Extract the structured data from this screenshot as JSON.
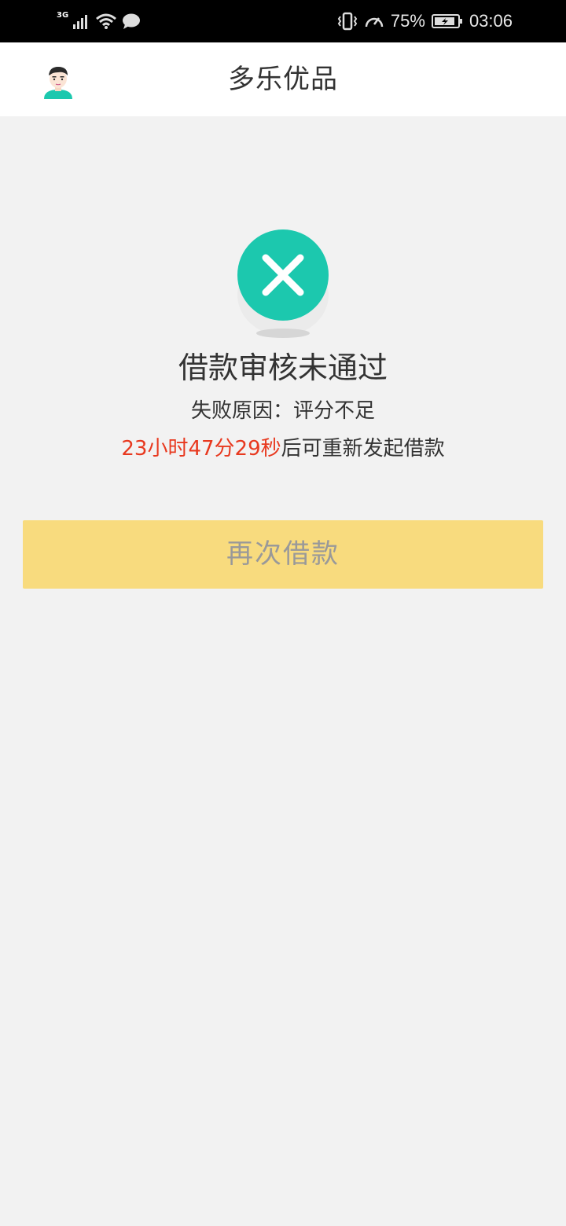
{
  "status_bar": {
    "network": "3G",
    "battery_percent": "75%",
    "time": "03:06",
    "icons": [
      "signal-icon",
      "wifi-icon",
      "message-icon",
      "vibrate-icon",
      "speed-icon",
      "battery-icon"
    ]
  },
  "header": {
    "title": "多乐优品",
    "avatar_icon": "user-avatar-icon"
  },
  "result": {
    "icon": "fail-x-icon",
    "icon_color": "#1cc8ae",
    "title": "借款审核未通过",
    "reason": "失败原因：评分不足",
    "countdown": "23小时47分29秒",
    "countdown_suffix": "后可重新发起借款",
    "countdown_color": "#e8391f"
  },
  "actions": {
    "retry_label": "再次借款",
    "retry_bg": "#f8db7e"
  }
}
